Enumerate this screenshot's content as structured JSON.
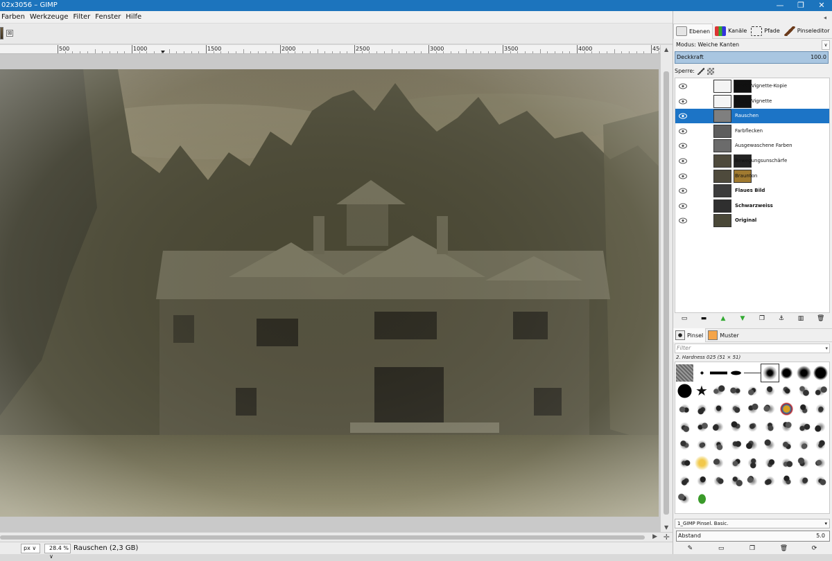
{
  "window": {
    "title": "02x3056 – GIMP",
    "minimize": "—",
    "restore": "❐",
    "close": "✕"
  },
  "menu": [
    "Farben",
    "Werkzeuge",
    "Filter",
    "Fenster",
    "Hilfe"
  ],
  "image_tab": {
    "close": "⊠"
  },
  "ruler": {
    "labels": [
      "500",
      "1000",
      "1500",
      "2000",
      "2500",
      "3000",
      "3500",
      "4000",
      "450"
    ]
  },
  "statusbar": {
    "unit": "px",
    "zoom": "28.4 %",
    "message": "Rauschen (2,3 GB)"
  },
  "dock": {
    "tabs": [
      {
        "label": "Ebenen",
        "icon": "layers-icon"
      },
      {
        "label": "Kanäle",
        "icon": "channels-icon"
      },
      {
        "label": "Pfade",
        "icon": "paths-icon"
      },
      {
        "label": "Pinseleditor",
        "icon": "brush-editor-icon"
      }
    ],
    "mode_label": "Modus: Weiche Kanten",
    "opacity_label": "Deckkraft",
    "opacity_value": "100.0",
    "lock_label": "Sperre:",
    "layers": [
      {
        "name": "Weiße Vignette-Kopie",
        "bold": false,
        "selected": false
      },
      {
        "name": "Weiße Vignette",
        "bold": false,
        "selected": false
      },
      {
        "name": "Rauschen",
        "bold": false,
        "selected": true
      },
      {
        "name": "Farbflecken",
        "bold": false,
        "selected": false
      },
      {
        "name": "Ausgewaschene Farben",
        "bold": false,
        "selected": false
      },
      {
        "name": "Bewegungsunschärfe",
        "bold": false,
        "selected": false
      },
      {
        "name": "Braunton",
        "bold": false,
        "selected": false
      },
      {
        "name": "Flaues Bild",
        "bold": true,
        "selected": false
      },
      {
        "name": "Schwarzweiss",
        "bold": true,
        "selected": false
      },
      {
        "name": "Original",
        "bold": true,
        "selected": false
      }
    ],
    "brush_tabs": [
      {
        "label": "Pinsel",
        "icon": "brush-icon"
      },
      {
        "label": "Muster",
        "icon": "pattern-icon"
      }
    ],
    "filter_placeholder": "Filter",
    "brush_name": "2. Hardness 025 (51 × 51)",
    "brush_set": "1_GIMP Pinsel. Basic.",
    "spacing_label": "Abstand",
    "spacing_value": "5.0"
  },
  "colors": {
    "titlebar": "#1c74bd",
    "selection": "#1c74c6",
    "opacity_bar": "#a9c6e1"
  }
}
